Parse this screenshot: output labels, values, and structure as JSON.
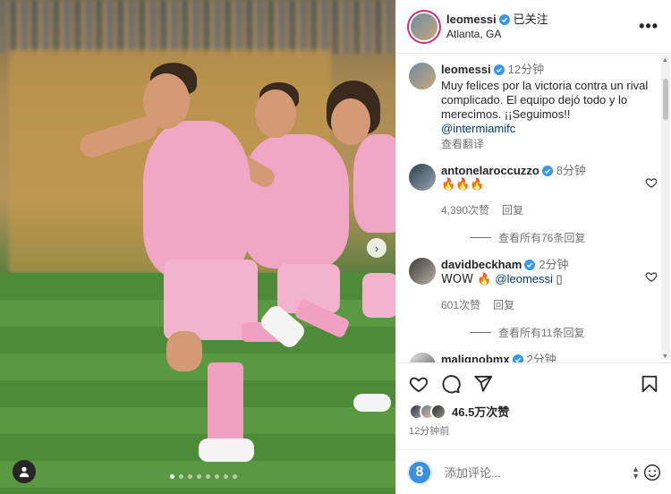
{
  "post": {
    "header": {
      "username": "leomessi",
      "follow_state": "已关注",
      "location": "Atlanta, GA",
      "more_label": "•••"
    },
    "caption": {
      "username": "leomessi",
      "time": "12分钟",
      "text": "Muy felices por la victoria contra un rival complicado. El equipo dejó todo y lo merecimos. ¡¡Seguimos!!",
      "mention": "@intermiamifc",
      "translate_label": "查看翻译"
    },
    "comments": [
      {
        "username": "antonelaroccuzzo",
        "time": "8分钟",
        "text": "🔥🔥🔥",
        "likes": "4,390次赞",
        "reply_label": "回复",
        "view_replies": "查看所有76条回复"
      },
      {
        "username": "davidbeckham",
        "time": "2分钟",
        "text_prefix": "WOW 🔥 ",
        "mention": "@leomessi",
        "text_suffix": " ▯",
        "likes": "601次赞",
        "reply_label": "回复",
        "view_replies": "查看所有11条回复"
      },
      {
        "username": "malignobmx",
        "time": "2分钟"
      }
    ],
    "likes_total": "46.5万次赞",
    "posted_time": "12分钟前",
    "composer": {
      "avatar_letter": "8",
      "placeholder": "添加评论..."
    },
    "next_arrow": "›",
    "carousel_count": 8,
    "carousel_active": 0
  },
  "colors": {
    "verified": "#3797f0",
    "story_ring": "#d62976",
    "link": "#00376b",
    "muted": "#737373"
  },
  "icons": [
    "more-icon",
    "verified-badge-icon",
    "heart-icon",
    "comment-icon",
    "share-icon",
    "bookmark-icon",
    "emoji-icon",
    "user-tag-icon",
    "next-arrow-icon"
  ]
}
